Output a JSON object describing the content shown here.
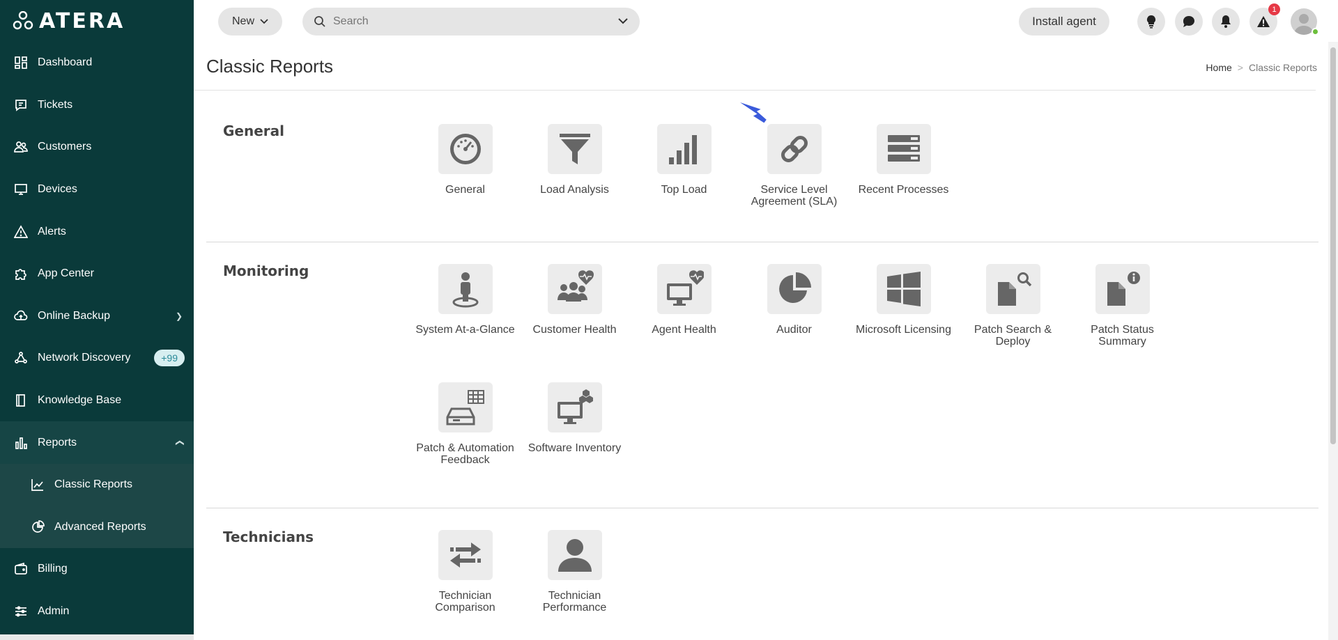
{
  "app": {
    "logo_text": "ATERA"
  },
  "sidebar": {
    "items": [
      {
        "label": "Dashboard",
        "icon": "dashboard-icon"
      },
      {
        "label": "Tickets",
        "icon": "ticket-icon"
      },
      {
        "label": "Customers",
        "icon": "customers-icon"
      },
      {
        "label": "Devices",
        "icon": "monitor-icon"
      },
      {
        "label": "Alerts",
        "icon": "alert-icon"
      },
      {
        "label": "App Center",
        "icon": "puzzle-icon"
      },
      {
        "label": "Online Backup",
        "icon": "cloud-icon"
      },
      {
        "label": "Network Discovery",
        "icon": "network-icon",
        "badge": "+99"
      },
      {
        "label": "Knowledge Base",
        "icon": "book-icon"
      },
      {
        "label": "Reports",
        "icon": "bar-chart-icon"
      },
      {
        "label": "Classic Reports",
        "icon": "line-chart-icon"
      },
      {
        "label": "Advanced Reports",
        "icon": "pie-chart-icon"
      },
      {
        "label": "Billing",
        "icon": "wallet-icon"
      },
      {
        "label": "Admin",
        "icon": "sliders-icon"
      }
    ]
  },
  "topbar": {
    "new_label": "New",
    "search_placeholder": "Search",
    "install_label": "Install agent",
    "alert_count": "1"
  },
  "page": {
    "title": "Classic Reports",
    "breadcrumb_home": "Home",
    "breadcrumb_sep": ">",
    "breadcrumb_current": "Classic Reports"
  },
  "sections": {
    "general": {
      "title": "General",
      "tiles": [
        "General",
        "Load Analysis",
        "Top Load",
        "Service Level Agreement (SLA)",
        "Recent Processes"
      ]
    },
    "monitoring": {
      "title": "Monitoring",
      "tiles": [
        "System At-a-Glance",
        "Customer Health",
        "Agent Health",
        "Auditor",
        "Microsoft Licensing",
        "Patch Search & Deploy",
        "Patch Status Summary",
        "Patch & Automation Feedback",
        "Software Inventory"
      ]
    },
    "technicians": {
      "title": "Technicians",
      "tiles": [
        "Technician Comparison",
        "Technician Performance"
      ]
    }
  },
  "colors": {
    "sidebar_bg": "#0a3a3a",
    "accent_badge": "#2a8a99",
    "arrow": "#3b5bdb",
    "icon_gray": "#666666"
  }
}
